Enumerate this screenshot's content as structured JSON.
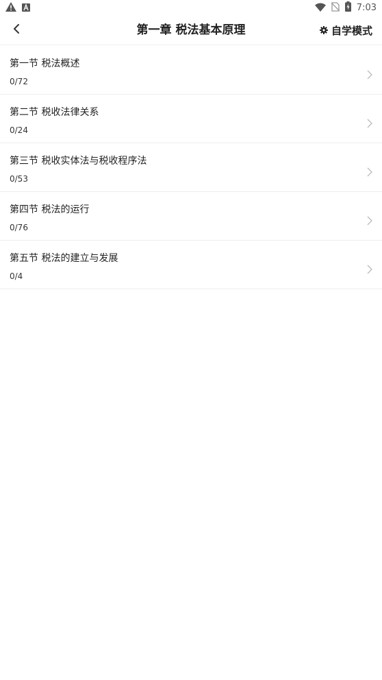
{
  "status_bar": {
    "time": "7:03",
    "left_icons": [
      "warning-icon",
      "a-badge-icon"
    ],
    "right_icons": [
      "wifi-icon",
      "no-sim-icon",
      "battery-charging-icon"
    ]
  },
  "header": {
    "title": "第一章 税法基本原理",
    "back_icon": "chevron-left-icon",
    "self_study": {
      "icon": "gear-icon",
      "label": "自学模式"
    }
  },
  "sections": [
    {
      "title": "第一节 税法概述",
      "progress": "0/72"
    },
    {
      "title": "第二节 税收法律关系",
      "progress": "0/24"
    },
    {
      "title": "第三节 税收实体法与税收程序法",
      "progress": "0/53"
    },
    {
      "title": "第四节 税法的运行",
      "progress": "0/76"
    },
    {
      "title": "第五节 税法的建立与发展",
      "progress": "0/4"
    }
  ],
  "colors": {
    "text": "#222222",
    "divider": "#eeeeee",
    "chevron": "#bbbbbb"
  }
}
